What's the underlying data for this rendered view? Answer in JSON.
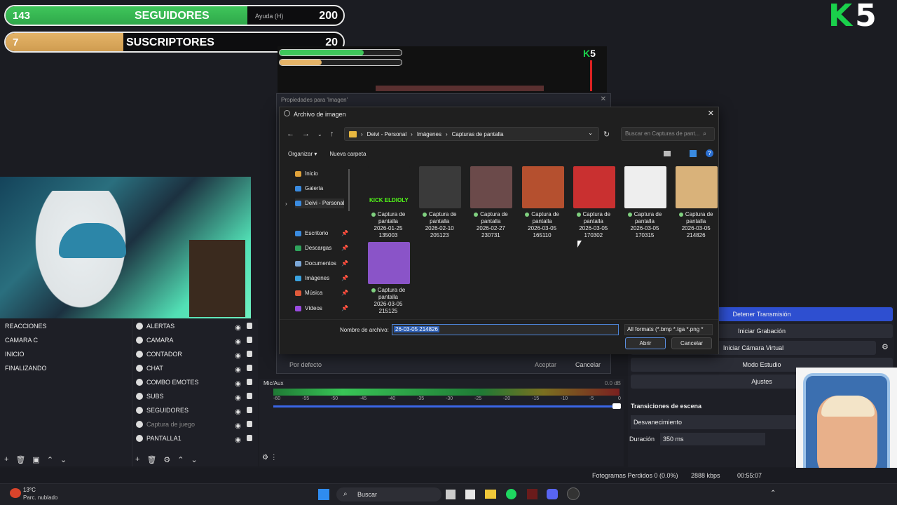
{
  "overlay": {
    "followers": {
      "current": "143",
      "label": "SEGUIDORES",
      "help": "Ayuda (H)",
      "goal": "200",
      "progress": 0.715
    },
    "subscribers": {
      "current": "7",
      "label": "SUSCRIPTORES",
      "goal": "20",
      "progress": 0.35
    },
    "logo_k": "K",
    "logo_5": "5"
  },
  "props_dialog": {
    "title": "Propiedades para 'Imagen'",
    "default_btn": "Por defecto",
    "accept_btn": "Aceptar",
    "cancel_btn": "Cancelar"
  },
  "file_dialog": {
    "title": "Archivo de imagen",
    "breadcrumb": [
      "Deivi - Personal",
      "Imágenes",
      "Capturas de pantalla"
    ],
    "search_placeholder": "Buscar en Capturas de pant...",
    "organize": "Organizar",
    "new_folder": "Nueva carpeta",
    "nav": [
      {
        "label": "Inicio",
        "color": "#e0a23a"
      },
      {
        "label": "Galería",
        "color": "#3a8be0"
      },
      {
        "label": "Deivi - Personal",
        "color": "#3a8be0"
      },
      {
        "label": "Escritorio",
        "color": "#3a8be0"
      },
      {
        "label": "Descargas",
        "color": "#2fa35c"
      },
      {
        "label": "Documentos",
        "color": "#7ba7d8"
      },
      {
        "label": "Imágenes",
        "color": "#3aa3e0"
      },
      {
        "label": "Música",
        "color": "#e05a3a"
      },
      {
        "label": "Vídeos",
        "color": "#9a4be0"
      }
    ],
    "files": [
      {
        "l1": "Captura de",
        "l2": "pantalla",
        "l3": "2026-01-25",
        "l4": "135003",
        "thumb_text": "KICK ELDIOLY",
        "color": "#1f1f1f"
      },
      {
        "l1": "Captura de",
        "l2": "pantalla",
        "l3": "2026-02-10",
        "l4": "205123",
        "color": "#3a3a3a"
      },
      {
        "l1": "Captura de",
        "l2": "pantalla",
        "l3": "2026-02-27",
        "l4": "230731",
        "color": "#6b4a4a"
      },
      {
        "l1": "Captura de",
        "l2": "pantalla",
        "l3": "2026-03-05",
        "l4": "165110",
        "color": "#b5502f"
      },
      {
        "l1": "Captura de",
        "l2": "pantalla",
        "l3": "2026-03-05",
        "l4": "170302",
        "color": "#c93030"
      },
      {
        "l1": "Captura de",
        "l2": "pantalla",
        "l3": "2026-03-05",
        "l4": "170315",
        "color": "#eeeeee"
      },
      {
        "l1": "Captura de",
        "l2": "pantalla",
        "l3": "2026-03-05",
        "l4": "214826",
        "color": "#d9b27a"
      },
      {
        "l1": "Captura de",
        "l2": "pantalla",
        "l3": "2026-03-05",
        "l4": "215125",
        "color": "#8a54c8"
      }
    ],
    "filename_label": "Nombre de archivo:",
    "filename_value": "26-03-05 214826",
    "filetype": "All formats (*.bmp *.tga *.png *",
    "open_btn": "Abrir",
    "cancel_btn": "Cancelar"
  },
  "scenes": [
    "REACCIONES",
    "CAMARA C",
    "INICIO",
    "FINALIZANDO"
  ],
  "sources": [
    {
      "label": "ALERTAS",
      "dim": false
    },
    {
      "label": "CAMARA",
      "dim": false
    },
    {
      "label": "CONTADOR",
      "dim": false
    },
    {
      "label": "CHAT",
      "dim": false
    },
    {
      "label": "COMBO EMOTES",
      "dim": false
    },
    {
      "label": "SUBS",
      "dim": false
    },
    {
      "label": "SEGUIDORES",
      "dim": false
    },
    {
      "label": "Captura de juego",
      "dim": true
    },
    {
      "label": "PANTALLA1",
      "dim": false
    }
  ],
  "mixer": {
    "track": "Mic/Aux",
    "db": "0.0 dB",
    "ticks": [
      "-60",
      "-55",
      "-50",
      "-45",
      "-40",
      "-35",
      "-30",
      "-25",
      "-20",
      "-15",
      "-10",
      "-5",
      "0"
    ]
  },
  "controls": {
    "stop_stream": "Detener Transmisión",
    "start_rec": "Iniciar Grabación",
    "virtual_cam": "Iniciar Cámara Virtual",
    "studio": "Modo Estudio",
    "settings": "Ajustes"
  },
  "transitions": {
    "title": "Transiciones de escena",
    "type": "Desvanecimiento",
    "duration_label": "Duración",
    "duration_value": "350 ms"
  },
  "status": {
    "frames": "Fotogramas Perdidos 0 (0.0%)",
    "kbps": "2888 kbps",
    "time": "00:55:07"
  },
  "taskbar": {
    "temp": "13°C",
    "weather": "Parc. nublado",
    "search": "Buscar"
  },
  "colors": {
    "accent_green": "#1ad04b",
    "obs_blue": "#2e4fd0"
  }
}
